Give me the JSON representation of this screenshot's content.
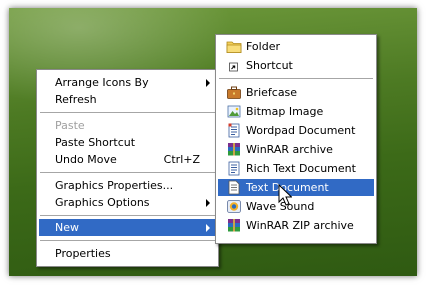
{
  "context_menu": {
    "items": [
      {
        "label": "Arrange Icons By",
        "has_submenu": true
      },
      {
        "label": "Refresh"
      },
      {
        "label": "Paste",
        "disabled": true
      },
      {
        "label": "Paste Shortcut"
      },
      {
        "label": "Undo Move",
        "shortcut": "Ctrl+Z"
      },
      {
        "label": "Graphics Properties..."
      },
      {
        "label": "Graphics Options",
        "has_submenu": true
      },
      {
        "label": "New",
        "has_submenu": true,
        "highlighted": true
      },
      {
        "label": "Properties"
      }
    ]
  },
  "new_submenu": {
    "items": [
      {
        "label": "Folder",
        "icon": "folder-icon"
      },
      {
        "label": "Shortcut",
        "icon": "shortcut-icon"
      },
      {
        "label": "Briefcase",
        "icon": "briefcase-icon"
      },
      {
        "label": "Bitmap Image",
        "icon": "bitmap-icon"
      },
      {
        "label": "Wordpad Document",
        "icon": "wordpad-icon"
      },
      {
        "label": "WinRAR archive",
        "icon": "winrar-icon"
      },
      {
        "label": "Rich Text Document",
        "icon": "rtf-icon"
      },
      {
        "label": "Text Document",
        "icon": "text-document-icon",
        "highlighted": true
      },
      {
        "label": "Wave Sound",
        "icon": "wave-sound-icon"
      },
      {
        "label": "WinRAR ZIP archive",
        "icon": "winrar-zip-icon"
      }
    ]
  },
  "colors": {
    "highlight": "#316ac5",
    "disabled_text": "#a0a0a0",
    "desktop_green": "#4d7a23"
  }
}
